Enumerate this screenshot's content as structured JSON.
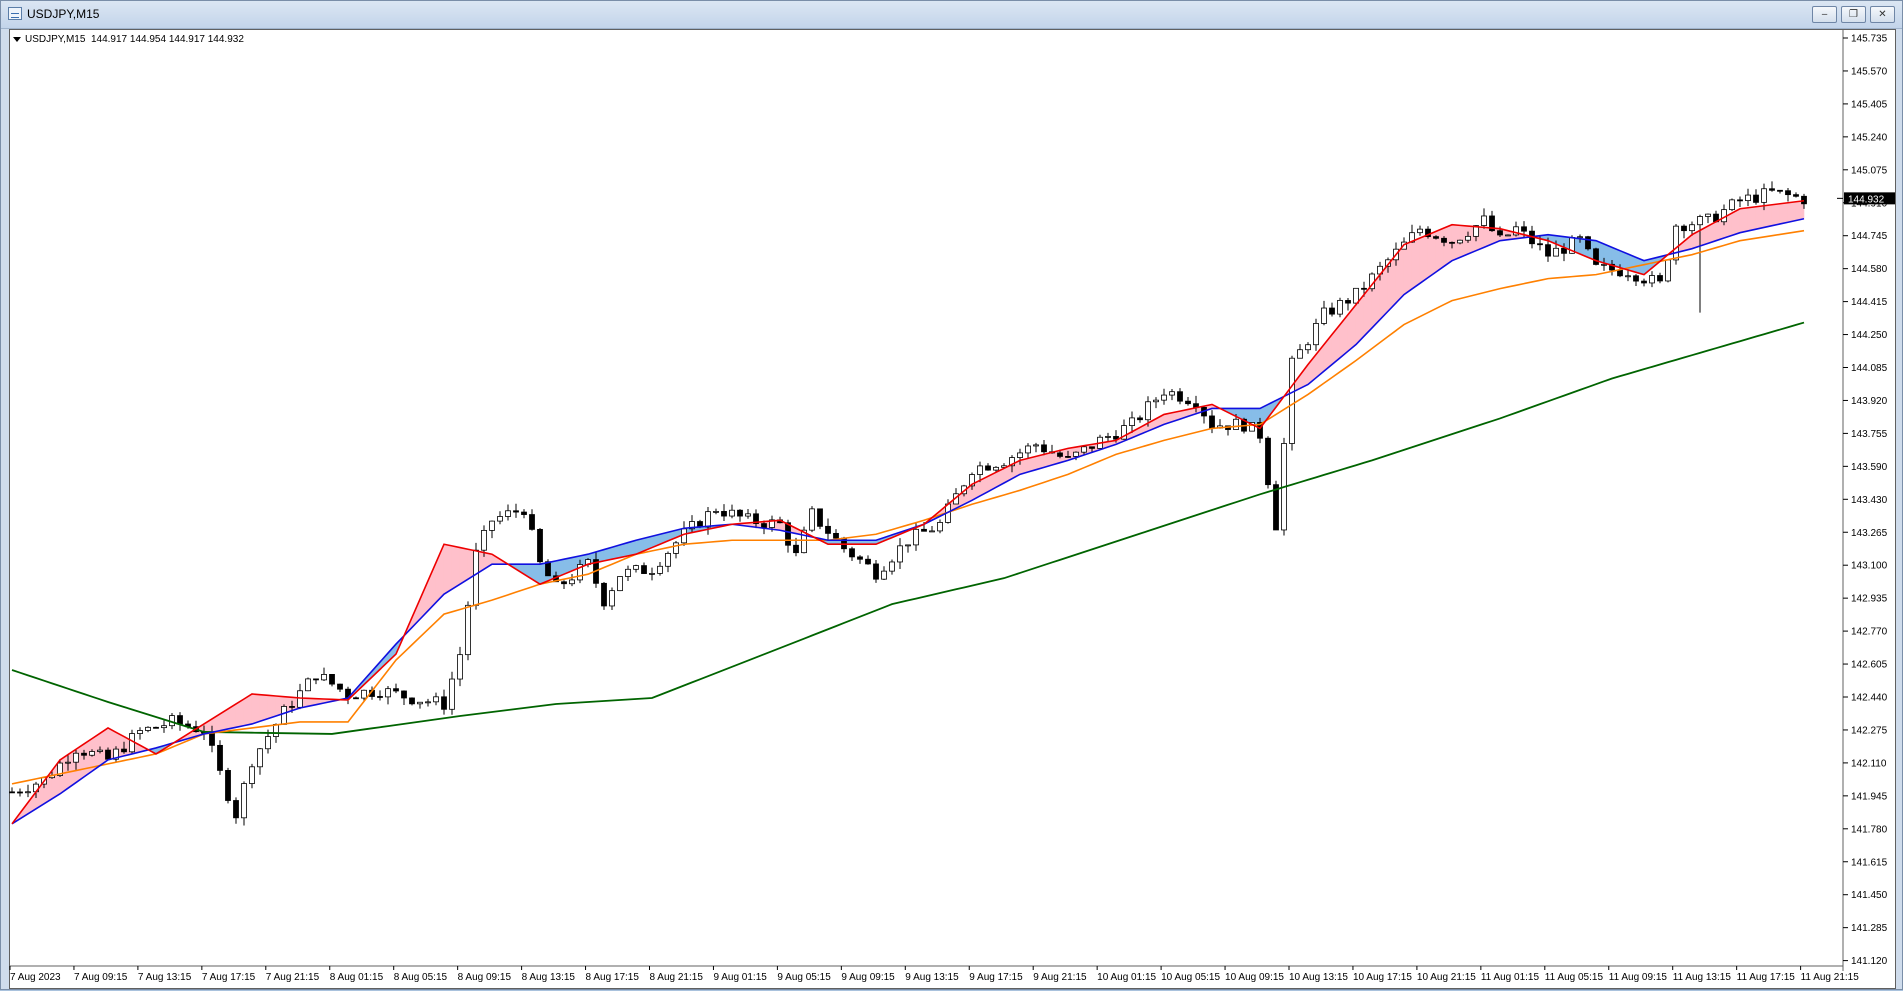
{
  "window": {
    "title": "USDJPY,M15",
    "buttons": {
      "minimize": "‒",
      "restore": "❐",
      "close": "✕"
    }
  },
  "chart": {
    "info_symbol": "USDJPY,M15",
    "info_ohlc": "144.917 144.954 144.917 144.932",
    "current_price": "144.932",
    "colors": {
      "fast_ma": "#ee0000",
      "mid_ma": "#1010e0",
      "slow_ma": "#ff8000",
      "long_ma": "#006400",
      "bull_cloud": "#ffc0cb",
      "bear_cloud": "#87bde8",
      "candle": "#000000"
    }
  },
  "chart_data": {
    "type": "candlestick",
    "price_ticks": [
      "145.735",
      "145.570",
      "145.405",
      "145.240",
      "145.075",
      "144.910",
      "144.745",
      "144.580",
      "144.415",
      "144.250",
      "144.085",
      "143.920",
      "143.755",
      "143.590",
      "143.430",
      "143.265",
      "143.100",
      "142.935",
      "142.770",
      "142.605",
      "142.440",
      "142.275",
      "142.110",
      "141.945",
      "141.780",
      "141.615",
      "141.450",
      "141.285",
      "141.120"
    ],
    "time_labels": [
      "7 Aug 2023",
      "7 Aug 09:15",
      "7 Aug 13:15",
      "7 Aug 17:15",
      "7 Aug 21:15",
      "8 Aug 01:15",
      "8 Aug 05:15",
      "8 Aug 09:15",
      "8 Aug 13:15",
      "8 Aug 17:15",
      "8 Aug 21:15",
      "9 Aug 01:15",
      "9 Aug 05:15",
      "9 Aug 09:15",
      "9 Aug 13:15",
      "9 Aug 17:15",
      "9 Aug 21:15",
      "10 Aug 01:15",
      "10 Aug 05:15",
      "10 Aug 09:15",
      "10 Aug 13:15",
      "10 Aug 17:15",
      "10 Aug 21:15",
      "11 Aug 01:15",
      "11 Aug 05:15",
      "11 Aug 09:15",
      "11 Aug 13:15",
      "11 Aug 17:15",
      "11 Aug 21:15"
    ],
    "ylim": [
      141.12,
      145.8
    ],
    "price_path": [
      [
        0,
        141.96
      ],
      [
        4,
        142.02
      ],
      [
        8,
        142.18
      ],
      [
        12,
        142.12
      ],
      [
        16,
        142.26
      ],
      [
        20,
        142.31
      ],
      [
        24,
        142.27
      ],
      [
        26,
        142.05
      ],
      [
        28,
        141.85
      ],
      [
        30,
        142.12
      ],
      [
        34,
        142.36
      ],
      [
        38,
        142.55
      ],
      [
        42,
        142.45
      ],
      [
        46,
        142.47
      ],
      [
        50,
        142.43
      ],
      [
        54,
        142.4
      ],
      [
        56,
        142.65
      ],
      [
        58,
        143.15
      ],
      [
        60,
        143.32
      ],
      [
        64,
        143.38
      ],
      [
        66,
        143.1
      ],
      [
        68,
        142.98
      ],
      [
        72,
        143.1
      ],
      [
        74,
        142.92
      ],
      [
        76,
        143.05
      ],
      [
        80,
        143.08
      ],
      [
        84,
        143.25
      ],
      [
        88,
        143.38
      ],
      [
        92,
        143.32
      ],
      [
        96,
        143.3
      ],
      [
        98,
        143.14
      ],
      [
        100,
        143.35
      ],
      [
        104,
        143.18
      ],
      [
        108,
        143.06
      ],
      [
        112,
        143.22
      ],
      [
        116,
        143.3
      ],
      [
        120,
        143.58
      ],
      [
        124,
        143.62
      ],
      [
        128,
        143.7
      ],
      [
        132,
        143.62
      ],
      [
        136,
        143.72
      ],
      [
        140,
        143.8
      ],
      [
        144,
        143.97
      ],
      [
        148,
        143.92
      ],
      [
        150,
        143.8
      ],
      [
        154,
        143.8
      ],
      [
        156,
        143.75
      ],
      [
        158,
        143.3
      ],
      [
        160,
        144.1
      ],
      [
        164,
        144.35
      ],
      [
        168,
        144.45
      ],
      [
        172,
        144.62
      ],
      [
        176,
        144.78
      ],
      [
        180,
        144.72
      ],
      [
        184,
        144.82
      ],
      [
        186,
        144.72
      ],
      [
        188,
        144.78
      ],
      [
        192,
        144.65
      ],
      [
        196,
        144.72
      ],
      [
        198,
        144.58
      ],
      [
        202,
        144.57
      ],
      [
        206,
        144.5
      ],
      [
        208,
        144.8
      ],
      [
        212,
        144.82
      ],
      [
        216,
        144.92
      ],
      [
        220,
        144.96
      ],
      [
        224,
        144.93
      ]
    ],
    "series": [
      {
        "name": "fast_ma",
        "points": [
          [
            0,
            141.8
          ],
          [
            6,
            142.12
          ],
          [
            12,
            142.28
          ],
          [
            18,
            142.15
          ],
          [
            24,
            142.3
          ],
          [
            30,
            142.45
          ],
          [
            36,
            142.43
          ],
          [
            42,
            142.42
          ],
          [
            48,
            142.65
          ],
          [
            54,
            143.2
          ],
          [
            60,
            143.15
          ],
          [
            66,
            143.0
          ],
          [
            72,
            143.1
          ],
          [
            78,
            143.15
          ],
          [
            84,
            143.25
          ],
          [
            90,
            143.3
          ],
          [
            96,
            143.32
          ],
          [
            102,
            143.2
          ],
          [
            108,
            143.2
          ],
          [
            114,
            143.3
          ],
          [
            120,
            143.5
          ],
          [
            126,
            143.62
          ],
          [
            132,
            143.68
          ],
          [
            138,
            143.72
          ],
          [
            144,
            143.85
          ],
          [
            150,
            143.9
          ],
          [
            156,
            143.78
          ],
          [
            162,
            144.1
          ],
          [
            168,
            144.4
          ],
          [
            174,
            144.7
          ],
          [
            180,
            144.8
          ],
          [
            186,
            144.78
          ],
          [
            192,
            144.72
          ],
          [
            198,
            144.62
          ],
          [
            204,
            144.55
          ],
          [
            210,
            144.75
          ],
          [
            216,
            144.88
          ],
          [
            224,
            144.92
          ]
        ]
      },
      {
        "name": "mid_ma",
        "points": [
          [
            0,
            141.8
          ],
          [
            6,
            141.95
          ],
          [
            12,
            142.12
          ],
          [
            18,
            142.18
          ],
          [
            24,
            142.25
          ],
          [
            30,
            142.3
          ],
          [
            36,
            142.38
          ],
          [
            42,
            142.43
          ],
          [
            48,
            142.7
          ],
          [
            54,
            142.95
          ],
          [
            60,
            143.1
          ],
          [
            66,
            143.1
          ],
          [
            72,
            143.15
          ],
          [
            78,
            143.22
          ],
          [
            84,
            143.28
          ],
          [
            90,
            143.3
          ],
          [
            96,
            143.27
          ],
          [
            102,
            143.22
          ],
          [
            108,
            143.22
          ],
          [
            114,
            143.3
          ],
          [
            120,
            143.42
          ],
          [
            126,
            143.55
          ],
          [
            132,
            143.62
          ],
          [
            138,
            143.7
          ],
          [
            144,
            143.8
          ],
          [
            150,
            143.88
          ],
          [
            156,
            143.88
          ],
          [
            162,
            144.0
          ],
          [
            168,
            144.2
          ],
          [
            174,
            144.45
          ],
          [
            180,
            144.62
          ],
          [
            186,
            144.72
          ],
          [
            192,
            144.75
          ],
          [
            198,
            144.72
          ],
          [
            204,
            144.62
          ],
          [
            210,
            144.68
          ],
          [
            216,
            144.76
          ],
          [
            224,
            144.83
          ]
        ]
      },
      {
        "name": "slow_ma",
        "points": [
          [
            0,
            142.0
          ],
          [
            6,
            142.05
          ],
          [
            12,
            142.1
          ],
          [
            18,
            142.15
          ],
          [
            24,
            142.25
          ],
          [
            30,
            142.28
          ],
          [
            36,
            142.31
          ],
          [
            42,
            142.31
          ],
          [
            48,
            142.62
          ],
          [
            54,
            142.85
          ],
          [
            60,
            142.92
          ],
          [
            66,
            143.0
          ],
          [
            72,
            143.05
          ],
          [
            78,
            143.15
          ],
          [
            84,
            143.2
          ],
          [
            90,
            143.22
          ],
          [
            96,
            143.22
          ],
          [
            102,
            143.22
          ],
          [
            108,
            143.25
          ],
          [
            114,
            143.32
          ],
          [
            120,
            143.4
          ],
          [
            126,
            143.47
          ],
          [
            132,
            143.55
          ],
          [
            138,
            143.65
          ],
          [
            144,
            143.72
          ],
          [
            150,
            143.78
          ],
          [
            156,
            143.8
          ],
          [
            162,
            143.95
          ],
          [
            168,
            144.12
          ],
          [
            174,
            144.3
          ],
          [
            180,
            144.42
          ],
          [
            186,
            144.48
          ],
          [
            192,
            144.53
          ],
          [
            198,
            144.55
          ],
          [
            204,
            144.6
          ],
          [
            210,
            144.65
          ],
          [
            216,
            144.72
          ],
          [
            224,
            144.77
          ]
        ]
      },
      {
        "name": "long_ma",
        "points": [
          [
            0,
            142.57
          ],
          [
            12,
            142.41
          ],
          [
            24,
            142.26
          ],
          [
            40,
            142.25
          ],
          [
            56,
            142.34
          ],
          [
            68,
            142.4
          ],
          [
            80,
            142.43
          ],
          [
            96,
            142.68
          ],
          [
            110,
            142.9
          ],
          [
            124,
            143.03
          ],
          [
            140,
            143.24
          ],
          [
            156,
            143.45
          ],
          [
            170,
            143.62
          ],
          [
            186,
            143.83
          ],
          [
            200,
            144.03
          ],
          [
            212,
            144.17
          ],
          [
            224,
            144.31
          ]
        ]
      }
    ]
  }
}
